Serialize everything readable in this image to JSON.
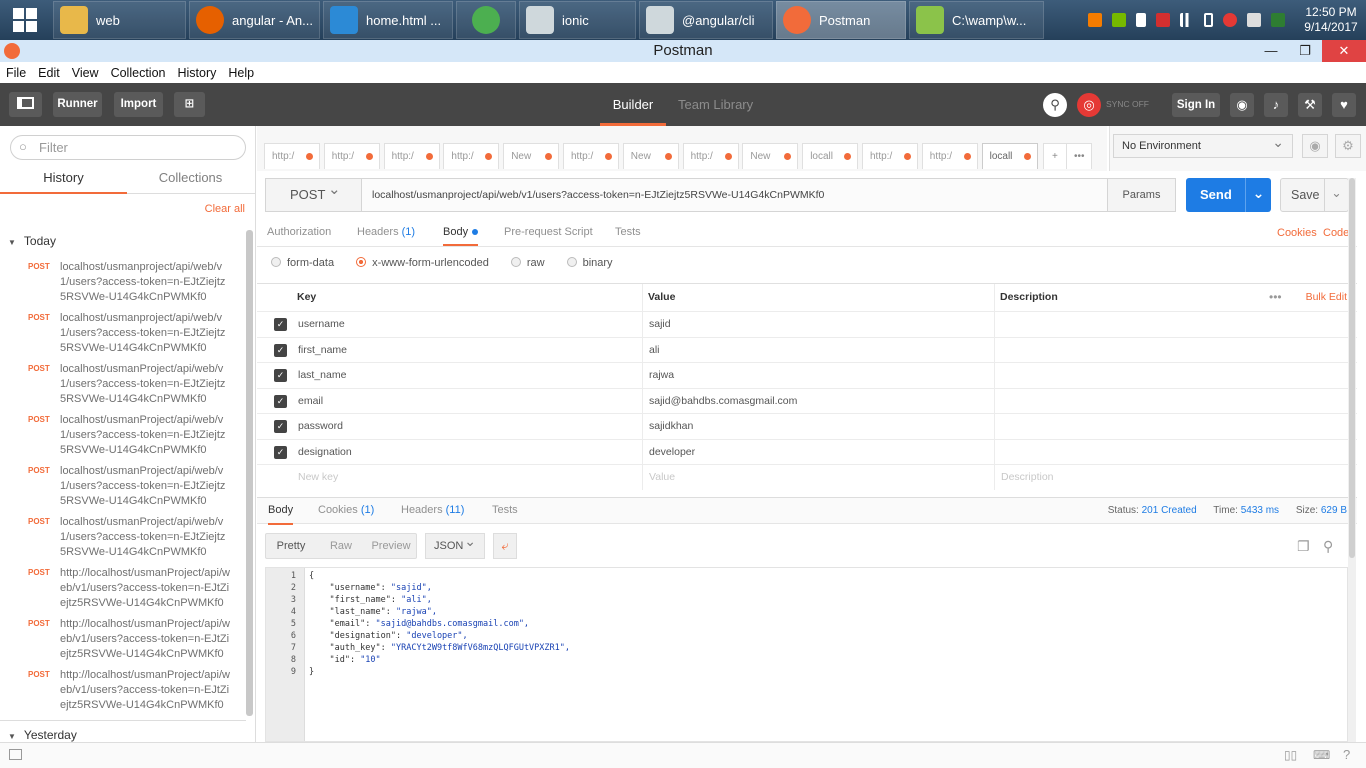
{
  "taskbar": {
    "tasks": [
      {
        "label": "web",
        "icon": "folder-icon",
        "color": "#e8b84a"
      },
      {
        "label": "angular - An...",
        "icon": "firefox-icon",
        "color": "#e66000"
      },
      {
        "label": "home.html ...",
        "icon": "vscode-icon",
        "color": "#2c8ad6"
      },
      {
        "label": "",
        "icon": "chrome-icon",
        "color": "#4caf50"
      },
      {
        "label": "ionic",
        "icon": "notepad-icon",
        "color": "#cfd8dc"
      },
      {
        "label": "@angular/cli",
        "icon": "notepad-icon",
        "color": "#cfd8dc"
      },
      {
        "label": "Postman",
        "icon": "postman-icon",
        "color": "#f26b3a"
      },
      {
        "label": "C:\\wamp\\w...",
        "icon": "notepadpp-icon",
        "color": "#8bc34a"
      }
    ],
    "clock_time": "12:50 PM",
    "clock_date": "9/14/2017"
  },
  "window": {
    "title": "Postman"
  },
  "menu": [
    "File",
    "Edit",
    "View",
    "Collection",
    "History",
    "Help"
  ],
  "toolbar": {
    "runner": "Runner",
    "import": "Import",
    "builder": "Builder",
    "team_library": "Team Library",
    "sync": "SYNC OFF",
    "sign_in": "Sign In"
  },
  "sidebar": {
    "filter_placeholder": "Filter",
    "tab_history": "History",
    "tab_collections": "Collections",
    "clear_all": "Clear all",
    "today": "Today",
    "yesterday": "Yesterday",
    "items": [
      {
        "method": "POST",
        "url": "localhost/usmanproject/api/web/v1/users?access-token=n-EJtZiejtz5RSVWe-U14G4kCnPWMKf0"
      },
      {
        "method": "POST",
        "url": "localhost/usmanproject/api/web/v1/users?access-token=n-EJtZiejtz5RSVWe-U14G4kCnPWMKf0"
      },
      {
        "method": "POST",
        "url": "localhost/usmanProject/api/web/v1/users?access-token=n-EJtZiejtz5RSVWe-U14G4kCnPWMKf0"
      },
      {
        "method": "POST",
        "url": "localhost/usmanProject/api/web/v1/users?access-token=n-EJtZiejtz5RSVWe-U14G4kCnPWMKf0"
      },
      {
        "method": "POST",
        "url": "localhost/usmanProject/api/web/v1/users?access-token=n-EJtZiejtz5RSVWe-U14G4kCnPWMKf0"
      },
      {
        "method": "POST",
        "url": "localhost/usmanProject/api/web/v1/users?access-token=n-EJtZiejtz5RSVWe-U14G4kCnPWMKf0"
      },
      {
        "method": "POST",
        "url": "http://localhost/usmanProject/api/web/v1/users?access-token=n-EJtZiejtz5RSVWe-U14G4kCnPWMKf0"
      },
      {
        "method": "POST",
        "url": "http://localhost/usmanProject/api/web/v1/users?access-token=n-EJtZiejtz5RSVWe-U14G4kCnPWMKf0"
      },
      {
        "method": "POST",
        "url": "http://localhost/usmanProject/api/web/v1/users?access-token=n-EJtZiejtz5RSVWe-U14G4kCnPWMKf0"
      }
    ]
  },
  "request_tabs": [
    "http:/",
    "http:/",
    "http:/",
    "http:/",
    "New",
    "http:/",
    "New",
    "http:/",
    "New",
    "locall",
    "http:/",
    "http:/",
    "locall"
  ],
  "environment": {
    "selected": "No Environment"
  },
  "request": {
    "method": "POST",
    "url": "localhost/usmanproject/api/web/v1/users?access-token=n-EJtZiejtz5RSVWe-U14G4kCnPWMKf0",
    "params": "Params",
    "send": "Send",
    "save": "Save"
  },
  "request_subtabs": {
    "authorization": "Authorization",
    "headers": "Headers",
    "headers_count": "(1)",
    "body": "Body",
    "prerequest": "Pre-request Script",
    "tests": "Tests",
    "cookies": "Cookies",
    "code": "Code"
  },
  "body_types": [
    "form-data",
    "x-www-form-urlencoded",
    "raw",
    "binary"
  ],
  "kv_table": {
    "key_header": "Key",
    "value_header": "Value",
    "description_header": "Description",
    "bulk_edit": "Bulk Edit",
    "rows": [
      {
        "key": "username",
        "value": "sajid"
      },
      {
        "key": "first_name",
        "value": "ali"
      },
      {
        "key": "last_name",
        "value": "rajwa"
      },
      {
        "key": "email",
        "value": "sajid@bahdbs.comasgmail.com"
      },
      {
        "key": "password",
        "value": "sajidkhan"
      },
      {
        "key": "designation",
        "value": "developer"
      }
    ],
    "new_key_placeholder": "New key",
    "new_value_placeholder": "Value",
    "new_desc_placeholder": "Description"
  },
  "response": {
    "tab_body": "Body",
    "tab_cookies": "Cookies",
    "cookies_count": "(1)",
    "tab_headers": "Headers",
    "headers_count": "(11)",
    "tab_tests": "Tests",
    "status_label": "Status:",
    "status_value": "201 Created",
    "time_label": "Time:",
    "time_value": "5433 ms",
    "size_label": "Size:",
    "size_value": "629 B",
    "view_pretty": "Pretty",
    "view_raw": "Raw",
    "view_preview": "Preview",
    "format": "JSON",
    "code_lines": [
      {
        "n": "1",
        "t": "{"
      },
      {
        "n": "2",
        "k": "    \"username\": ",
        "v": "\"sajid\","
      },
      {
        "n": "3",
        "k": "    \"first_name\": ",
        "v": "\"ali\","
      },
      {
        "n": "4",
        "k": "    \"last_name\": ",
        "v": "\"rajwa\","
      },
      {
        "n": "5",
        "k": "    \"email\": ",
        "v": "\"sajid@bahdbs.comasgmail.com\","
      },
      {
        "n": "6",
        "k": "    \"designation\": ",
        "v": "\"developer\","
      },
      {
        "n": "7",
        "k": "    \"auth_key\": ",
        "v": "\"YRACYt2W9tf8WfV68mzQLQFGUtVPXZR1\","
      },
      {
        "n": "8",
        "k": "    \"id\": ",
        "v": "\"10\""
      },
      {
        "n": "9",
        "t": "}"
      }
    ]
  }
}
